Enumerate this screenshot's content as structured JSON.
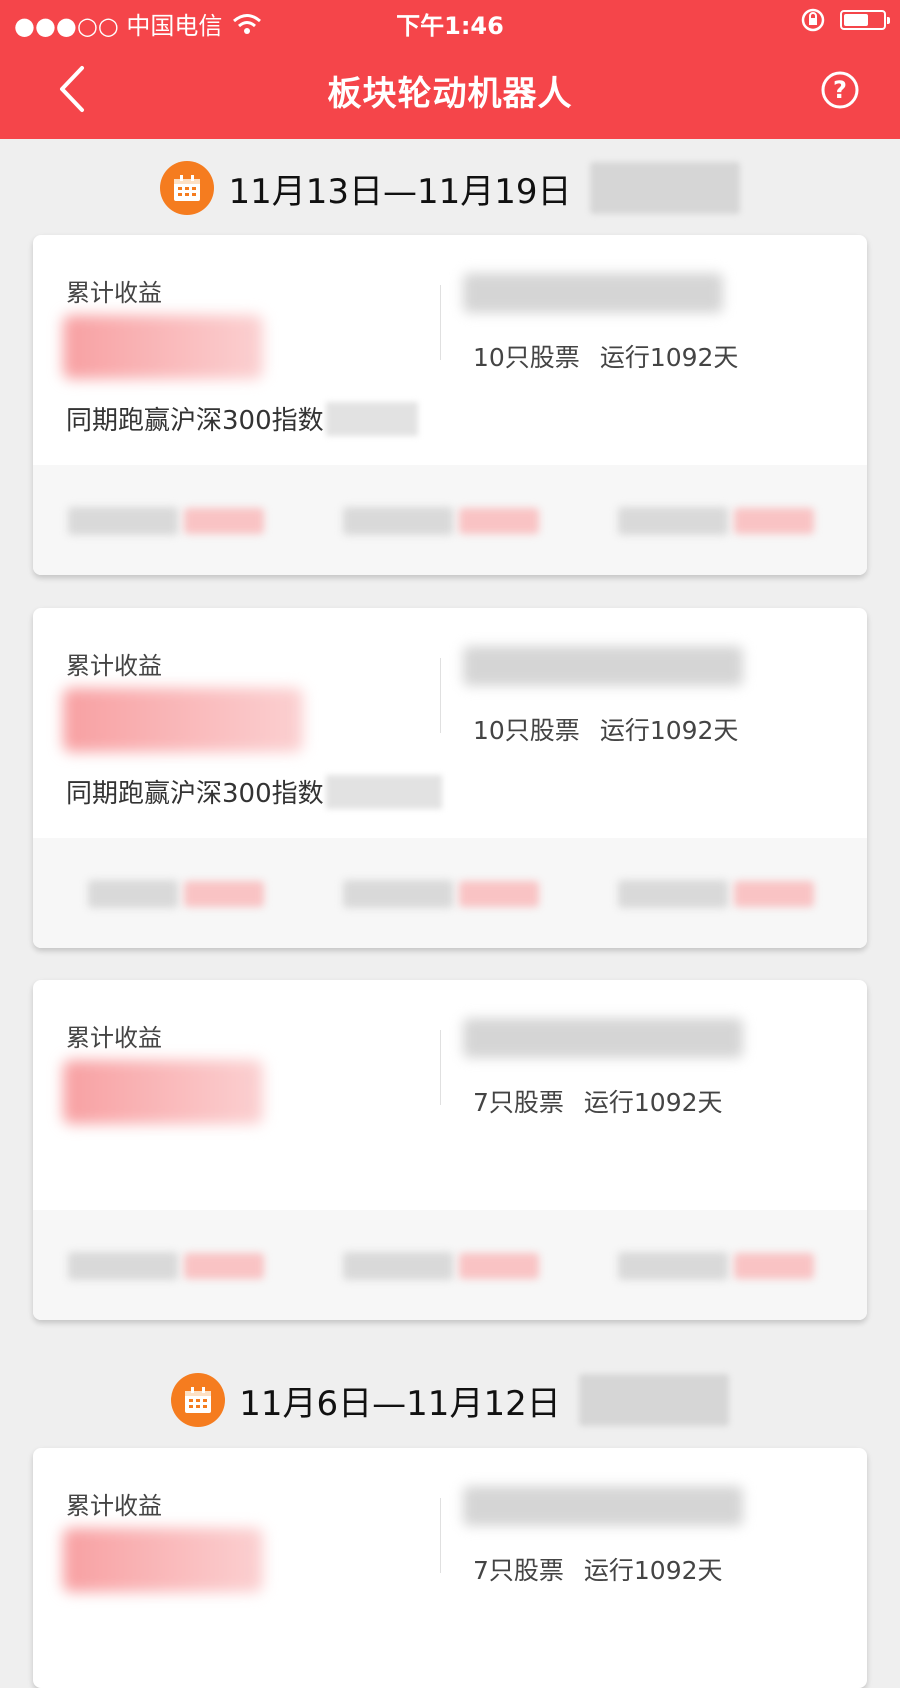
{
  "status_bar": {
    "carrier": "●●●○○ 中国电信",
    "time": "下午1:46"
  },
  "nav": {
    "title": "板块轮动机器人",
    "back_icon": "chevron-left-icon",
    "help_icon": "question-circle-icon"
  },
  "colors": {
    "header_bg": "#f5454a",
    "calendar_orange": "#f57c1f",
    "return_red": "#f5454a"
  },
  "periods": [
    {
      "range": "11月13日—11月19日",
      "cards": [
        {
          "label": "累计收益",
          "beat_text": "同期跑赢沪深300指数",
          "stock_count": "10只股票",
          "run_days": "运行1092天"
        },
        {
          "label": "累计收益",
          "beat_text": "同期跑赢沪深300指数",
          "stock_count": "10只股票",
          "run_days": "运行1092天"
        },
        {
          "label": "累计收益",
          "beat_text": "",
          "stock_count": "7只股票",
          "run_days": "运行1092天"
        }
      ]
    },
    {
      "range": "11月6日—11月12日",
      "cards": [
        {
          "label": "累计收益",
          "beat_text": "",
          "stock_count": "7只股票",
          "run_days": "运行1092天"
        }
      ]
    }
  ]
}
